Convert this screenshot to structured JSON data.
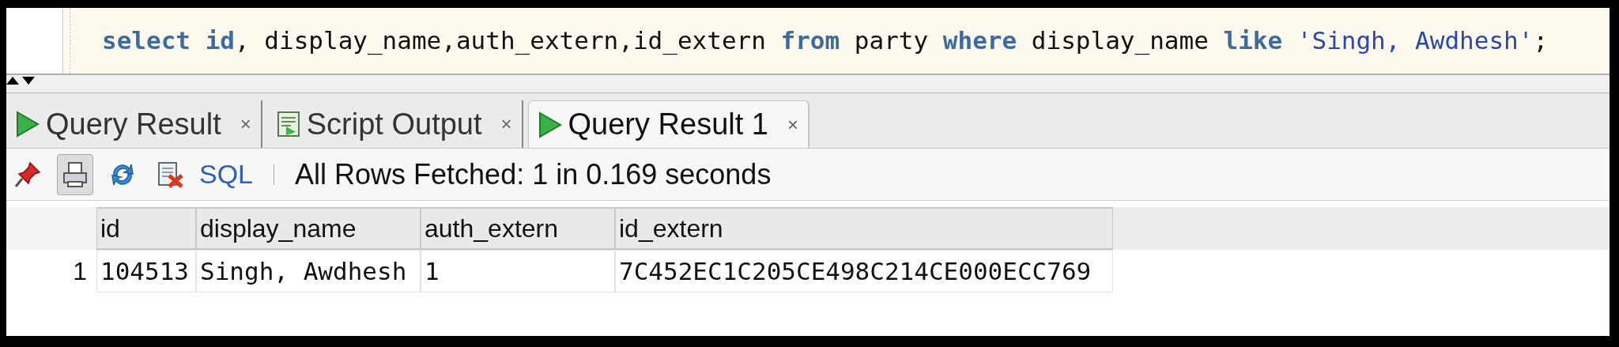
{
  "editor": {
    "tokens": [
      {
        "kind": "keyword",
        "text": "select"
      },
      {
        "kind": "keyword",
        "text": " id"
      },
      {
        "kind": "plain",
        "text": ", display_name,auth_extern,id_extern "
      },
      {
        "kind": "keyword",
        "text": "from"
      },
      {
        "kind": "plain",
        "text": " party "
      },
      {
        "kind": "keyword",
        "text": "where"
      },
      {
        "kind": "plain",
        "text": " display_name "
      },
      {
        "kind": "keyword",
        "text": "like"
      },
      {
        "kind": "string",
        "text": " 'Singh, Awdhesh'"
      },
      {
        "kind": "plain",
        "text": ";"
      }
    ]
  },
  "tabs": [
    {
      "label": "Query Result",
      "kind": "run",
      "selected": false
    },
    {
      "label": "Script Output",
      "kind": "script",
      "selected": false
    },
    {
      "label": "Query Result 1",
      "kind": "run",
      "selected": true
    }
  ],
  "tab_close": "×",
  "toolbar": {
    "buttons": [
      {
        "kind": "pin",
        "pressed": false
      },
      {
        "kind": "print",
        "pressed": true
      },
      {
        "kind": "refresh",
        "pressed": false
      },
      {
        "kind": "delete",
        "pressed": false
      }
    ],
    "sql_link": "SQL",
    "status": "All Rows Fetched: 1 in 0.169 seconds"
  },
  "table": {
    "columns": [
      "id",
      "display_name",
      "auth_extern",
      "id_extern"
    ],
    "rows": [
      {
        "number": "1",
        "cells": [
          "104513",
          "Singh, Awdhesh",
          "1",
          "7C452EC1C205CE498C214CE000ECC769"
        ]
      }
    ]
  }
}
